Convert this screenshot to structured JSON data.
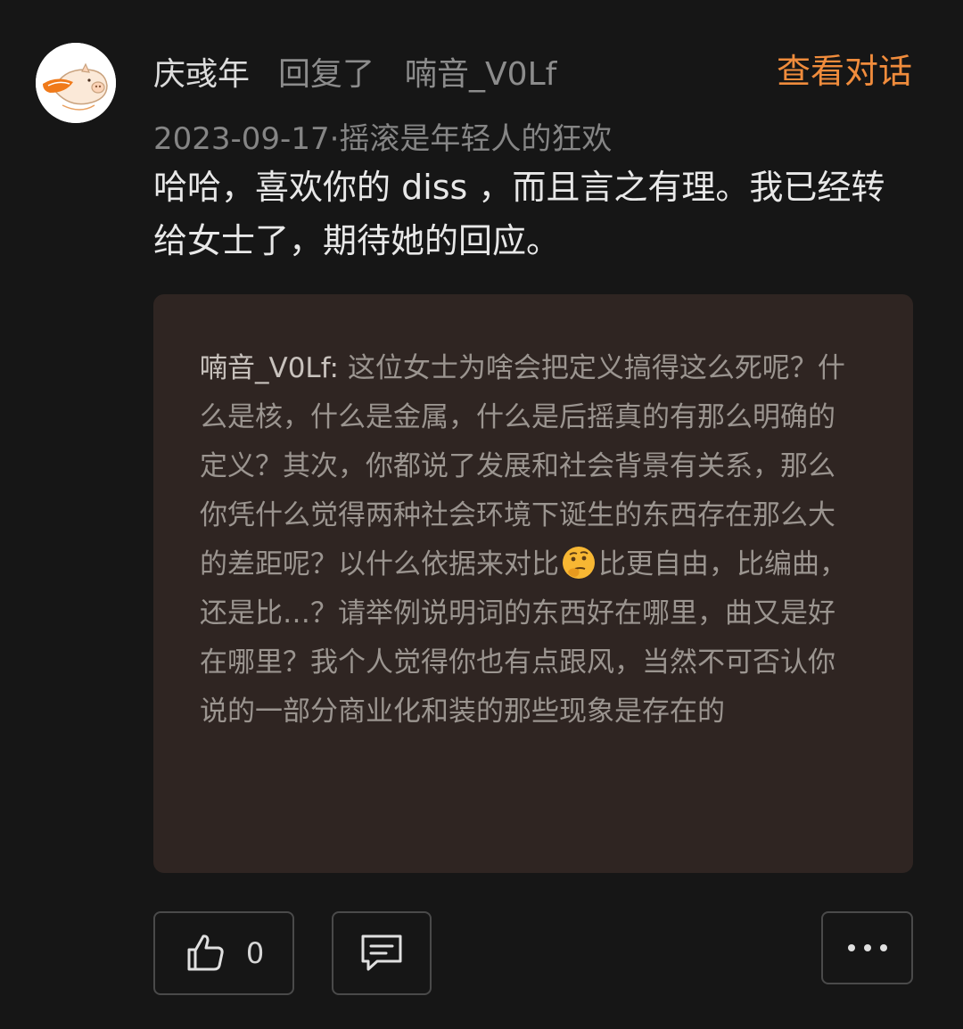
{
  "header": {
    "username": "庆彧年",
    "reply_word": "回复了",
    "reply_target": "喃音_V0Lf",
    "view_conversation": "查看对话"
  },
  "meta": {
    "line": "2023-09-17·摇滚是年轻人的狂欢"
  },
  "comment": {
    "text": "哈哈，喜欢你的 diss ，而且言之有理。我已经转给女士了，期待她的回应。"
  },
  "quote": {
    "author": "喃音_V0Lf:",
    "text_before_emoji": " 这位女士为啥会把定义搞得这么死呢？什么是核，什么是金属，什么是后摇真的有那么明确的定义？其次，你都说了发展和社会背景有关系，那么你凭什么觉得两种社会环境下诞生的东西存在那么大的差距呢？以什么依据来对比",
    "emoji": "thinking-face-icon",
    "text_after_emoji": "比更自由，比编曲，还是比…？请举例说明词的东西好在哪里，曲又是好在哪里？我个人觉得你也有点跟风，当然不可否认你说的一部分商业化和装的那些现象是存在的"
  },
  "actions": {
    "like_icon": "thumbs-up-icon",
    "like_count": "0",
    "comment_icon": "comment-icon",
    "more_icon": "more-dots-icon"
  },
  "colors": {
    "background": "#161616",
    "accent": "#f08c3c",
    "quote_background": "#2f2522"
  }
}
